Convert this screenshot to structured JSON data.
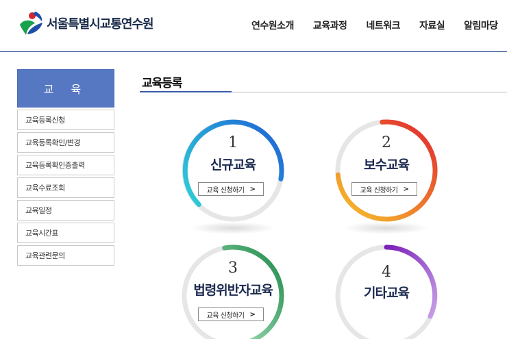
{
  "header": {
    "logo_text": "서울특별시교통연수원",
    "nav": [
      "연수원소개",
      "교육과정",
      "네트워크",
      "자료실",
      "알림마당"
    ]
  },
  "sidebar": {
    "title": "교 육",
    "items": [
      {
        "label": "교육등록신청"
      },
      {
        "label": "교육등록확인/변경"
      },
      {
        "label": "교육등록확인증출력"
      },
      {
        "label": "교육수료조회"
      },
      {
        "label": "교육일정"
      },
      {
        "label": "교육시간표"
      },
      {
        "label": "교육관련문의"
      }
    ]
  },
  "main": {
    "title": "교육등록",
    "cards": [
      {
        "number": "1",
        "name": "신규교육",
        "button": "교육 신청하기",
        "button_icon": "chevron-right-icon",
        "color_start": "#2fd3d8",
        "color_end": "#1f5fd6"
      },
      {
        "number": "2",
        "name": "보수교육",
        "button": "교육 신청하기",
        "button_icon": "chevron-right-icon",
        "color_start": "#f7c42c",
        "color_end": "#e0262f"
      },
      {
        "number": "3",
        "name": "법령위반자교육",
        "button": "교육 신청하기",
        "button_icon": "chevron-right-icon",
        "color_start": "#9ad9b0",
        "color_end": "#1f8a4a"
      },
      {
        "number": "4",
        "name": "기타교육",
        "button": "",
        "button_icon": "",
        "color_start": "#c7a0e8",
        "color_end": "#7b1fb8"
      }
    ]
  }
}
